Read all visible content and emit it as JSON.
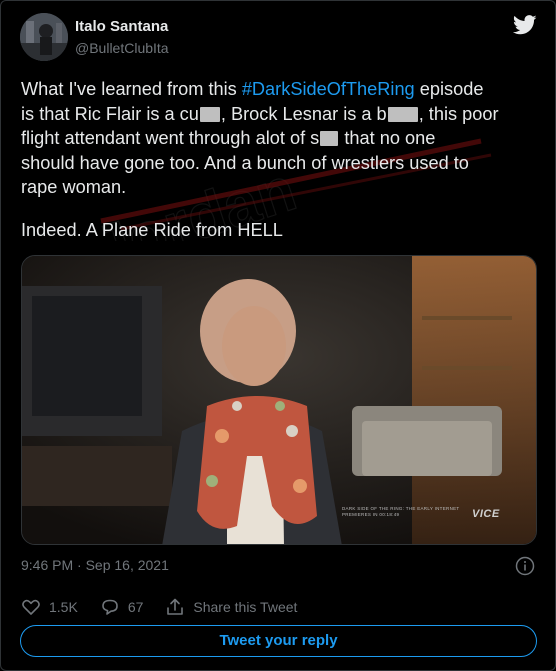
{
  "author": {
    "name": "Italo Santana",
    "handle": "@BulletClubIta"
  },
  "tweet": {
    "line1_before": "What I've learned from this ",
    "hashtag": "#DarkSideOfTheRing",
    "line1_after": " episode",
    "line2_a": "is that Ric Flair is a cu",
    "line2_b": ", Brock Lesnar is a b",
    "line2_c": ", this poor",
    "line3_a": "flight attendant went through alot of s",
    "line3_b": " that no one",
    "line4": "should have gone too. And a bunch of wrestlers used to",
    "line5": "rape woman.",
    "paragraph2": "Indeed. A Plane Ride from HELL"
  },
  "media": {
    "chyron": "DARK SIDE OF THE RING: THE EARLY INTERNET PREMIERES IN 00:18:49",
    "logo": "VICE"
  },
  "meta": {
    "timestamp": "9:46 PM · Sep 16, 2021"
  },
  "actions": {
    "likes": "1.5K",
    "replies": "67",
    "share_label": "Share this Tweet"
  },
  "reply_button": "Tweet your reply",
  "icons": {
    "platform": "twitter-bird-icon",
    "info": "info-icon",
    "like": "heart-icon",
    "reply": "reply-bubble-icon",
    "share": "share-icon"
  },
  "colors": {
    "accent": "#1d9bf0",
    "text": "#e7e9ea",
    "muted": "#71767b",
    "background": "#000000"
  }
}
